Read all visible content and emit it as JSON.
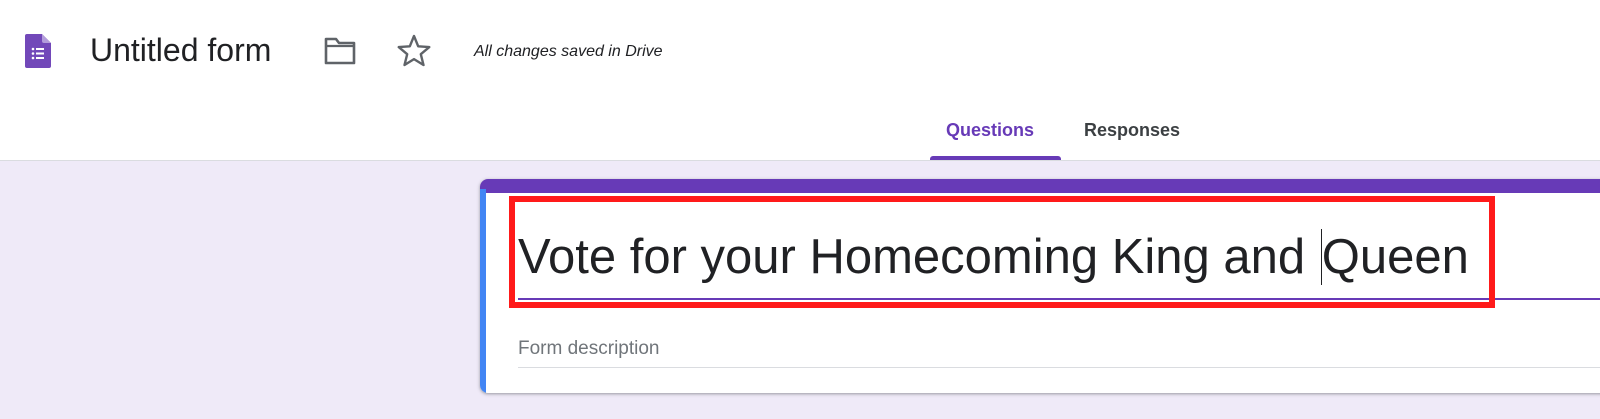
{
  "header": {
    "app_icon": "google-forms-icon",
    "title": "Untitled form",
    "folder_icon": "folder-icon",
    "star_icon": "star-icon",
    "save_status": "All changes saved in Drive"
  },
  "tabs": [
    {
      "label": "Questions",
      "active": true
    },
    {
      "label": "Responses",
      "active": false
    }
  ],
  "form": {
    "title_before_caret": "Vote for your Homecoming King and ",
    "title_after_caret": "Queen",
    "description_placeholder": "Form description"
  },
  "colors": {
    "accent": "#673ab7",
    "background": "#efeaf8",
    "focus_bar": "#4285f4",
    "highlight": "#ff1a1a"
  }
}
